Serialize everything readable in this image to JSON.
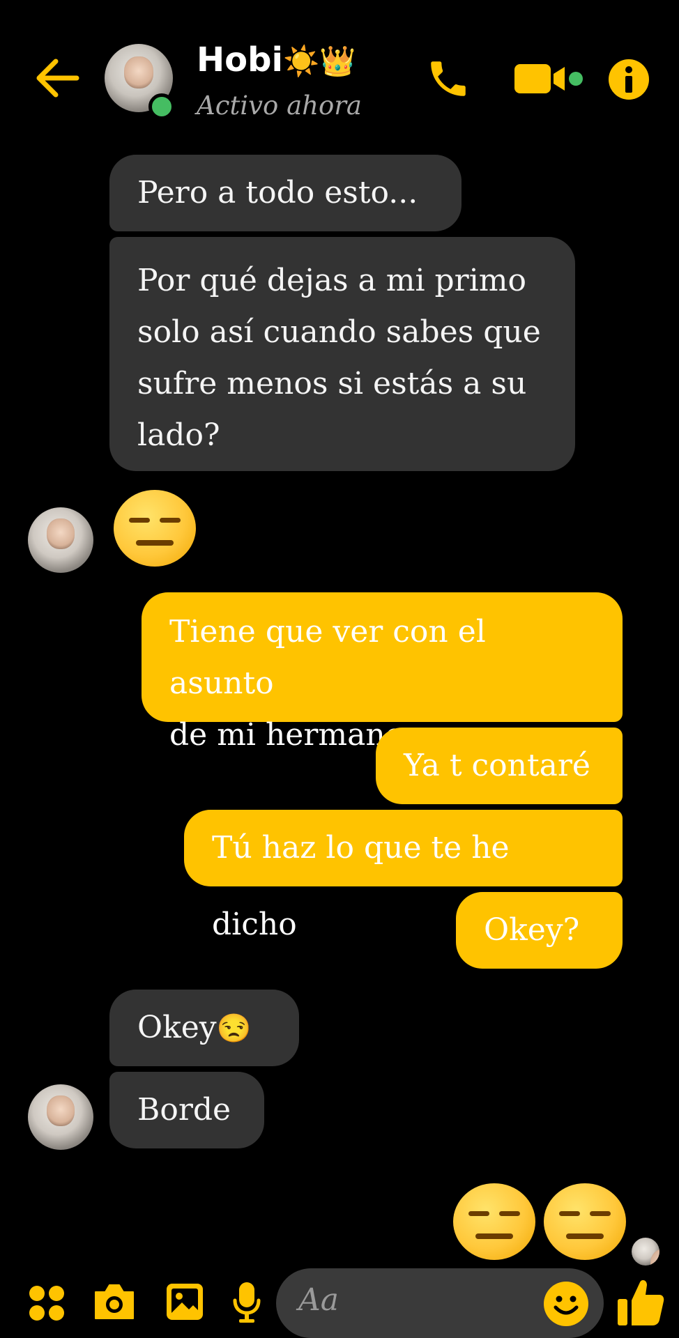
{
  "header": {
    "contact_name": "Hobi",
    "name_emojis": "☀️👑",
    "status": "Activo ahora"
  },
  "messages": [
    {
      "side": "in",
      "text": "Pero a todo esto..."
    },
    {
      "side": "in",
      "lines": [
        "Por qué dejas a mi primo",
        "solo así cuando sabes que",
        "sufre menos si estás a su",
        "lado?"
      ]
    },
    {
      "side": "in",
      "emoji": "😑"
    },
    {
      "side": "out",
      "lines": [
        "Tiene que ver con el asunto",
        "de mi hermano"
      ]
    },
    {
      "side": "out",
      "text": "Ya t contaré"
    },
    {
      "side": "out",
      "text": "Tú haz lo que te he dicho"
    },
    {
      "side": "out",
      "text": "Okey?"
    },
    {
      "side": "in",
      "text": "Okey",
      "emoji": "😒"
    },
    {
      "side": "in",
      "text": "Borde"
    },
    {
      "side": "out",
      "emoji": "😑😑"
    }
  ],
  "composer": {
    "placeholder": "Aa"
  },
  "colors": {
    "accent": "#ffc300",
    "incoming": "#333333",
    "online": "#45bd62",
    "background": "#000000"
  },
  "icons": [
    "back-arrow-icon",
    "phone-icon",
    "video-camera-icon",
    "info-icon",
    "apps-grid-icon",
    "camera-icon",
    "gallery-icon",
    "microphone-icon",
    "smiley-icon",
    "thumbs-up-icon"
  ]
}
